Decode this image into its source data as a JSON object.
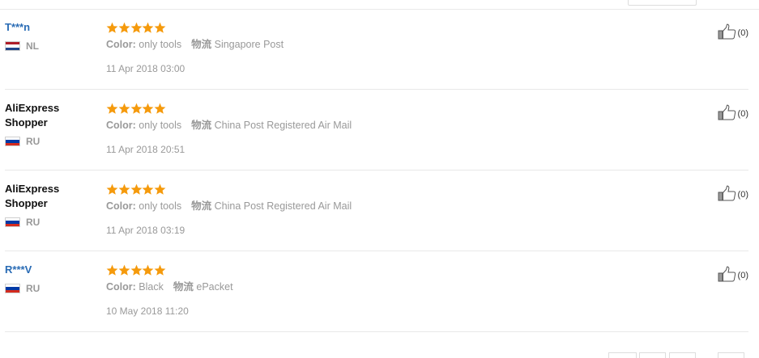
{
  "reviews": [
    {
      "name": "T***n",
      "masked": true,
      "country": "NL",
      "flag": [
        "#ae1c28",
        "#ffffff",
        "#21468b"
      ],
      "rating": 5,
      "color_label": "Color:",
      "color_value": "only tools",
      "ship_label": "物流",
      "ship_value": "Singapore Post",
      "date": "11 Apr 2018 03:00",
      "helpful": "(0)"
    },
    {
      "name": "AliExpress Shopper",
      "masked": false,
      "country": "RU",
      "flag": [
        "#ffffff",
        "#0039a6",
        "#d52b1e"
      ],
      "rating": 5,
      "color_label": "Color:",
      "color_value": "only tools",
      "ship_label": "物流",
      "ship_value": "China Post Registered Air Mail",
      "date": "11 Apr 2018 20:51",
      "helpful": "(0)"
    },
    {
      "name": "AliExpress Shopper",
      "masked": false,
      "country": "RU",
      "flag": [
        "#ffffff",
        "#0039a6",
        "#d52b1e"
      ],
      "rating": 5,
      "color_label": "Color:",
      "color_value": "only tools",
      "ship_label": "物流",
      "ship_value": "China Post Registered Air Mail",
      "date": "11 Apr 2018 03:19",
      "helpful": "(0)"
    },
    {
      "name": "R***V",
      "masked": true,
      "country": "RU",
      "flag": [
        "#ffffff",
        "#0039a6",
        "#d52b1e"
      ],
      "rating": 5,
      "color_label": "Color:",
      "color_value": "Black",
      "ship_label": "物流",
      "ship_value": "ePacket",
      "date": "10 May 2018 11:20",
      "helpful": "(0)"
    }
  ],
  "colors": {
    "star": "#f59a0c",
    "masked_name": "#2a6cb5",
    "meta_text": "#999999"
  },
  "icons": {
    "rating": "star-icon",
    "helpful": "thumbs-up-icon"
  }
}
